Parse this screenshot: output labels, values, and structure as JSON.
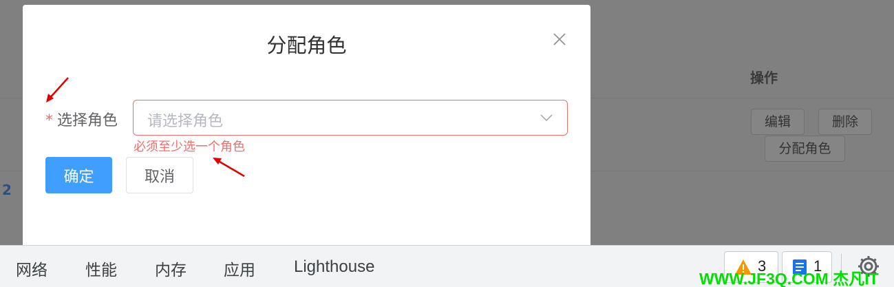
{
  "background": {
    "column_title": "操作",
    "row_buttons": {
      "edit": "编辑",
      "delete": "删除",
      "assign_role": "分配角色"
    },
    "row_index": "2"
  },
  "dialog": {
    "title": "分配角色",
    "field": {
      "required_mark": "*",
      "label": "选择角色",
      "placeholder": "请选择角色",
      "error": "必须至少选一个角色"
    },
    "buttons": {
      "confirm": "确定",
      "cancel": "取消"
    }
  },
  "devtools": {
    "tabs": [
      "网络",
      "性能",
      "内存",
      "应用",
      "Lighthouse"
    ],
    "warnings_count": "3",
    "messages_count": "1"
  },
  "watermark": "WWW.JF3Q.COM 杰凡IT",
  "colors": {
    "primary": "#409eff",
    "error": "#f56c6c",
    "annotation_arrow": "#e00000",
    "watermark": "#00e000"
  }
}
